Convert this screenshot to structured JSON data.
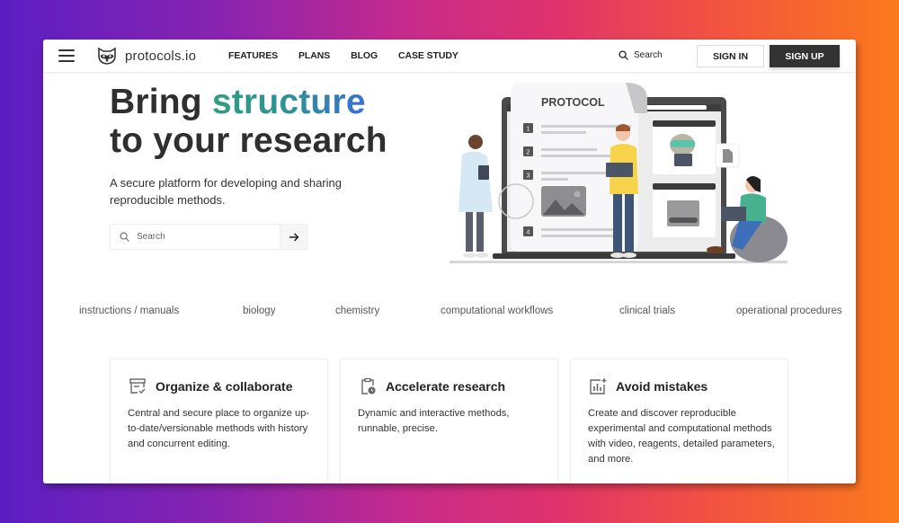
{
  "header": {
    "menu_icon": "hamburger-icon",
    "logo_icon": "raccoon-icon",
    "brand": "protocols.io",
    "nav": [
      {
        "label": "FEATURES"
      },
      {
        "label": "PLANS"
      },
      {
        "label": "BLOG"
      },
      {
        "label": "CASE STUDY"
      }
    ],
    "search_label": "Search",
    "search_icon": "search-icon",
    "sign_in": "SIGN IN",
    "sign_up": "SIGN UP"
  },
  "hero": {
    "title_prefix": "Bring ",
    "title_accent": "structure",
    "title_line2": "to your research",
    "subtitle": "A secure platform for developing and sharing reproducible methods.",
    "search_placeholder": "Search",
    "go_icon": "arrow-right-icon",
    "accent_colors": [
      "#2f9e7f",
      "#3a6fd6"
    ]
  },
  "illustration": {
    "document_heading": "PROTOCOL",
    "steps": [
      "1",
      "2",
      "3",
      "4"
    ]
  },
  "categories": [
    "instructions / manuals",
    "biology",
    "chemistry",
    "computational workflows",
    "clinical trials",
    "operational procedures"
  ],
  "cards": [
    {
      "icon": "organize-icon",
      "title": "Organize & collaborate",
      "description": "Central and secure place to organize up-to-date/versionable methods with history and concurrent editing."
    },
    {
      "icon": "clipboard-clock-icon",
      "title": "Accelerate research",
      "description": "Dynamic and interactive methods, runnable, precise."
    },
    {
      "icon": "chart-plus-icon",
      "title": "Avoid mistakes",
      "description": "Create and discover reproducible experimental and computational methods with video, reagents, detailed parameters, and more."
    }
  ]
}
